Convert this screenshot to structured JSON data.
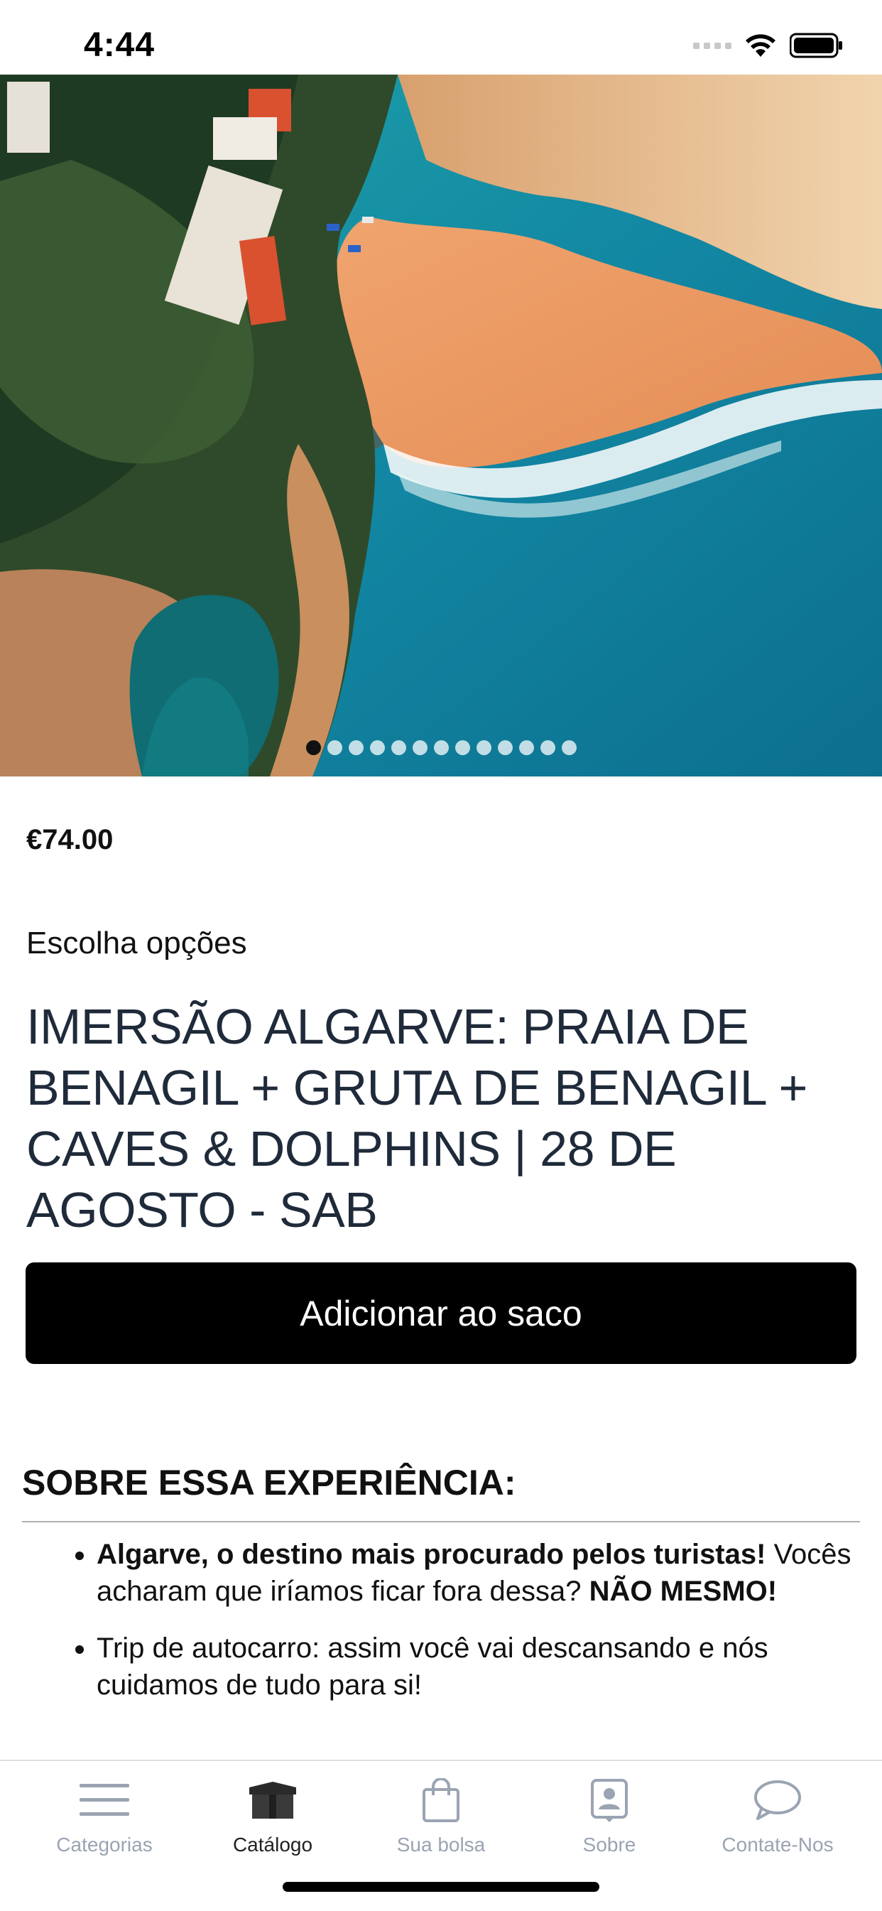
{
  "status": {
    "time": "4:44"
  },
  "hero": {
    "slide_count": 13,
    "active_slide": 1
  },
  "product": {
    "price": "€74.00",
    "options_label": "Escolha opções",
    "title": "IMERSÃO ALGARVE: PRAIA DE BENAGIL + GRUTA DE BENAGIL + CAVES & DOLPHINS | 28 DE AGOSTO - SAB",
    "add_button_label": "Adicionar ao saco"
  },
  "about": {
    "heading": "SOBRE ESSA EXPERIÊNCIA:",
    "bullet1_bold": "Algarve, o destino mais procurado pelos turistas!",
    "bullet1_text": " Vocês acharam que iríamos ficar fora dessa? ",
    "bullet1_bold_end": "NÃO MESMO!",
    "bullet2_text": "Trip de autocarro: assim você vai descansando e nós cuidamos de tudo para si!"
  },
  "tabs": [
    {
      "label": "Categorias",
      "icon": "menu-icon",
      "active": false
    },
    {
      "label": "Catálogo",
      "icon": "box-icon",
      "active": true
    },
    {
      "label": "Sua bolsa",
      "icon": "bag-icon",
      "active": false
    },
    {
      "label": "Sobre",
      "icon": "contact-card-icon",
      "active": false
    },
    {
      "label": "Contate-Nos",
      "icon": "chat-bubble-icon",
      "active": false
    }
  ],
  "colors": {
    "tab_inactive": "#9aa4b2",
    "tab_active": "#222222",
    "button_bg": "#000000",
    "title_color": "#1f2a3a"
  }
}
